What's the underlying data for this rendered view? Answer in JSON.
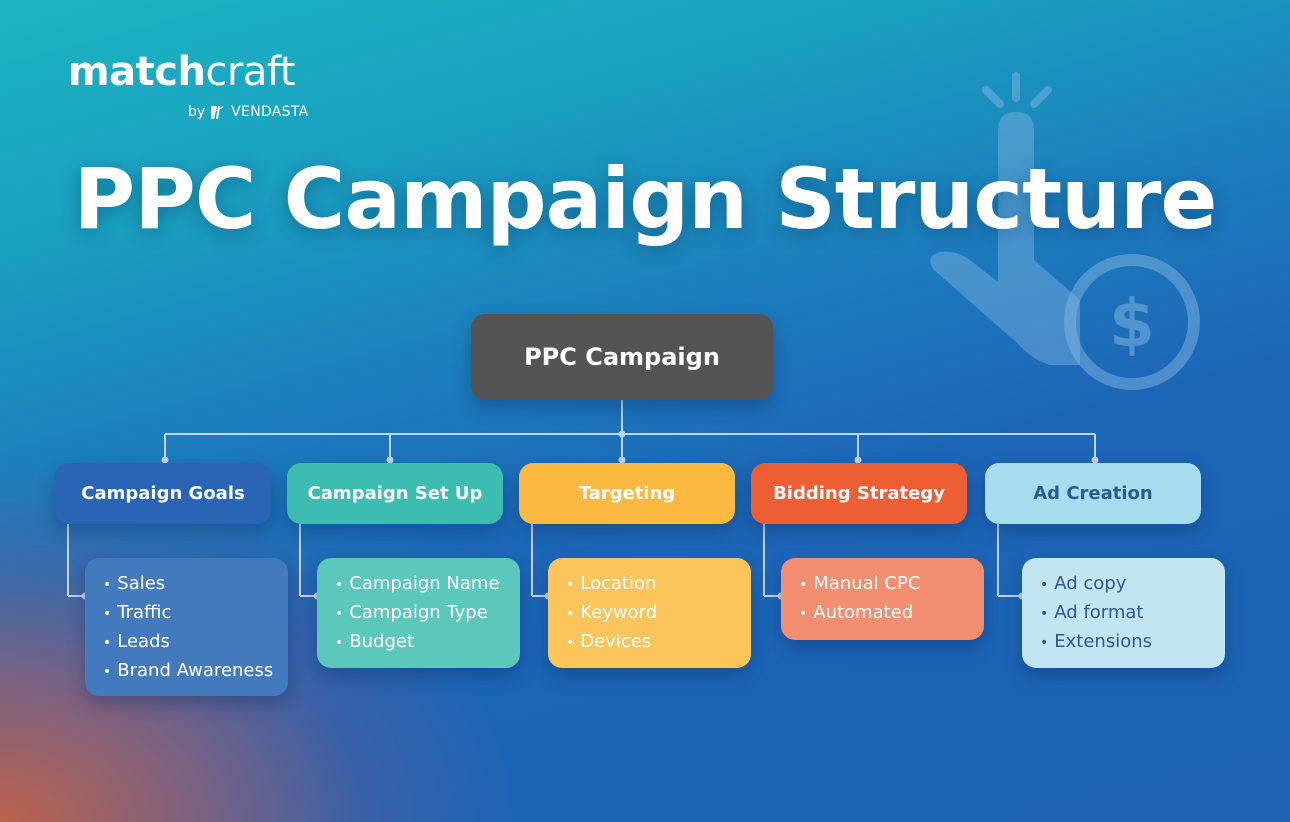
{
  "logo": {
    "brand_bold": "match",
    "brand_light": "craft",
    "by": "by",
    "parent": "VENDASTA"
  },
  "title": "PPC Campaign Structure",
  "decor": {
    "icon": "hand-click-dollar-icon"
  },
  "root": {
    "label": "PPC Campaign",
    "color": "#545454"
  },
  "categories": [
    {
      "label": "Campaign Goals",
      "color": "#2a65b5",
      "list_color": "#437abd",
      "text_color": "#ffffff",
      "items": [
        "Sales",
        "Traffic",
        "Leads",
        "Brand Awareness"
      ]
    },
    {
      "label": "Campaign Set Up",
      "color": "#3dbdb1",
      "list_color": "#5cc7bb",
      "text_color": "#ffffff",
      "items": [
        "Campaign Name",
        "Campaign Type",
        "Budget"
      ]
    },
    {
      "label": "Targeting",
      "color": "#fbb941",
      "list_color": "#fbc55c",
      "text_color": "#ffffff",
      "items": [
        "Location",
        "Keyword",
        "Devices"
      ]
    },
    {
      "label": "Bidding Strategy",
      "color": "#ee5e35",
      "list_color": "#f48e70",
      "text_color": "#ffffff",
      "items": [
        "Manual CPC",
        "Automated"
      ]
    },
    {
      "label": "Ad Creation",
      "color": "#a7dcee",
      "list_color": "#c2e5f1",
      "text_color": "#2c5a8c",
      "items": [
        "Ad copy",
        "Ad format",
        "Extensions"
      ]
    }
  ]
}
